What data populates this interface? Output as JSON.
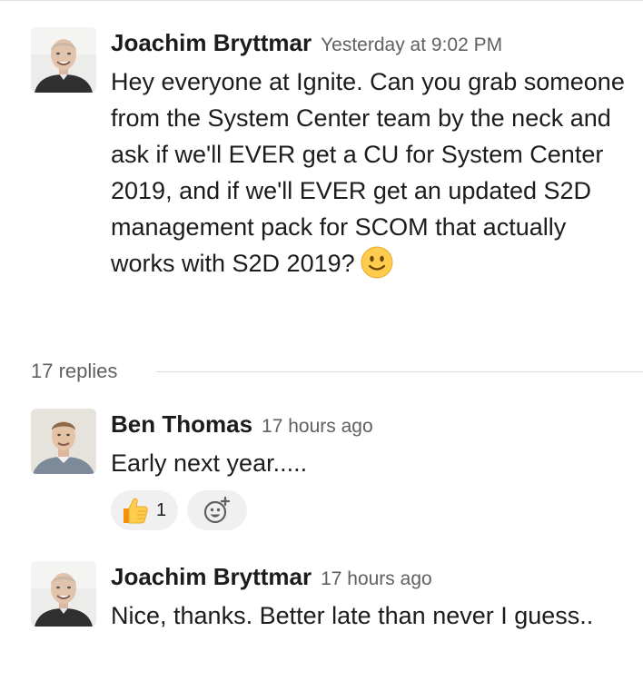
{
  "thread": {
    "parent": {
      "author": "Joachim Bryttmar",
      "timestamp": "Yesterday at 9:02 PM",
      "text": "Hey everyone at Ignite. Can you grab someone from the System Center team by the neck and ask if we'll EVER get a CU for System Center 2019, and if we'll EVER get an updated S2D management pack for SCOM that actually works with S2D 2019?",
      "emoji": "slightly-smiling-face"
    },
    "reply_count_label": "17 replies",
    "replies": [
      {
        "author": "Ben Thomas",
        "timestamp": "17 hours ago",
        "text": "Early next year.....",
        "reactions": [
          {
            "emoji": "thumbs-up",
            "count": "1"
          }
        ],
        "add_reaction_icon": "add-reaction-icon"
      },
      {
        "author": "Joachim Bryttmar",
        "timestamp": "17 hours ago",
        "text": "Nice, thanks. Better late than never I guess.."
      }
    ]
  },
  "colors": {
    "text": "#1d1c1d",
    "muted": "#616061",
    "reaction_bg": "#f0f0f0",
    "divider": "#dcdcdc"
  }
}
